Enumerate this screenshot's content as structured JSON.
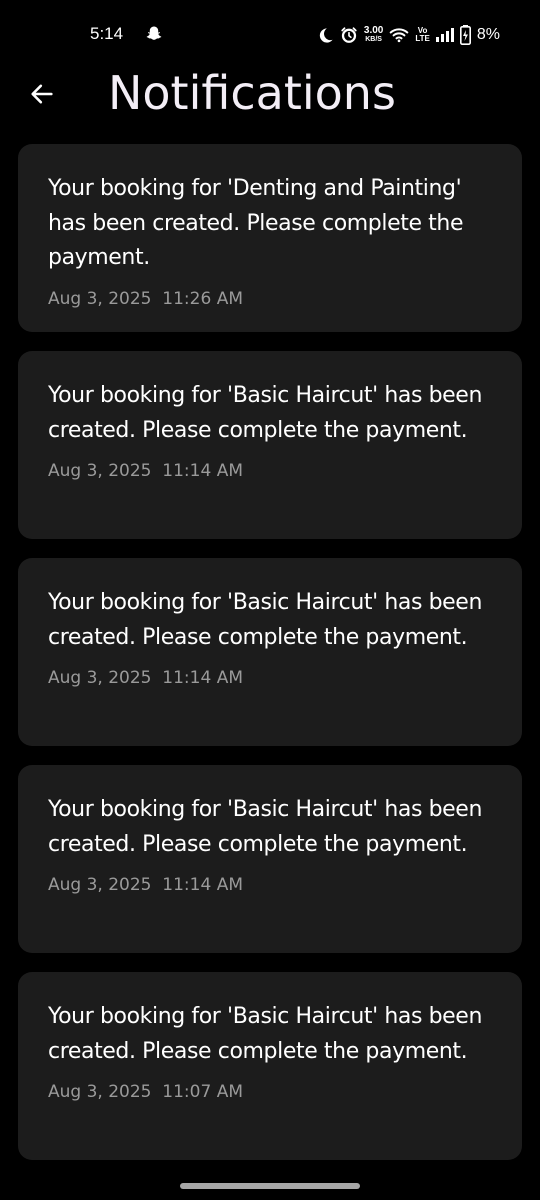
{
  "status_bar": {
    "time": "5:14",
    "net_speed_value": "3.00",
    "net_speed_unit": "KB/S",
    "volte_top": "Vo",
    "volte_bottom": "LTE",
    "battery_pct": "8%",
    "icons": [
      "snapchat-icon",
      "moon-icon",
      "alarm-icon",
      "wifi-icon",
      "signal-icon",
      "battery-charging-icon"
    ]
  },
  "header": {
    "title": "Notifications",
    "back_icon": "arrow-left-icon"
  },
  "notifications": [
    {
      "message": "Your booking for 'Denting and Painting' has been created. Please complete the payment.",
      "timestamp": "Aug 3, 2025  11:26 AM"
    },
    {
      "message": "Your booking for 'Basic Haircut' has been created. Please complete the payment.",
      "timestamp": "Aug 3, 2025  11:14 AM"
    },
    {
      "message": "Your booking for 'Basic Haircut' has been created. Please complete the payment.",
      "timestamp": "Aug 3, 2025  11:14 AM"
    },
    {
      "message": "Your booking for 'Basic Haircut' has been created. Please complete the payment.",
      "timestamp": "Aug 3, 2025  11:14 AM"
    },
    {
      "message": "Your booking for 'Basic Haircut' has been created. Please complete the payment.",
      "timestamp": "Aug 3, 2025  11:07 AM"
    }
  ],
  "colors": {
    "background": "#000000",
    "card": "#1c1c1c",
    "text": "#ffffff",
    "timestamp": "#9a9a9a"
  }
}
